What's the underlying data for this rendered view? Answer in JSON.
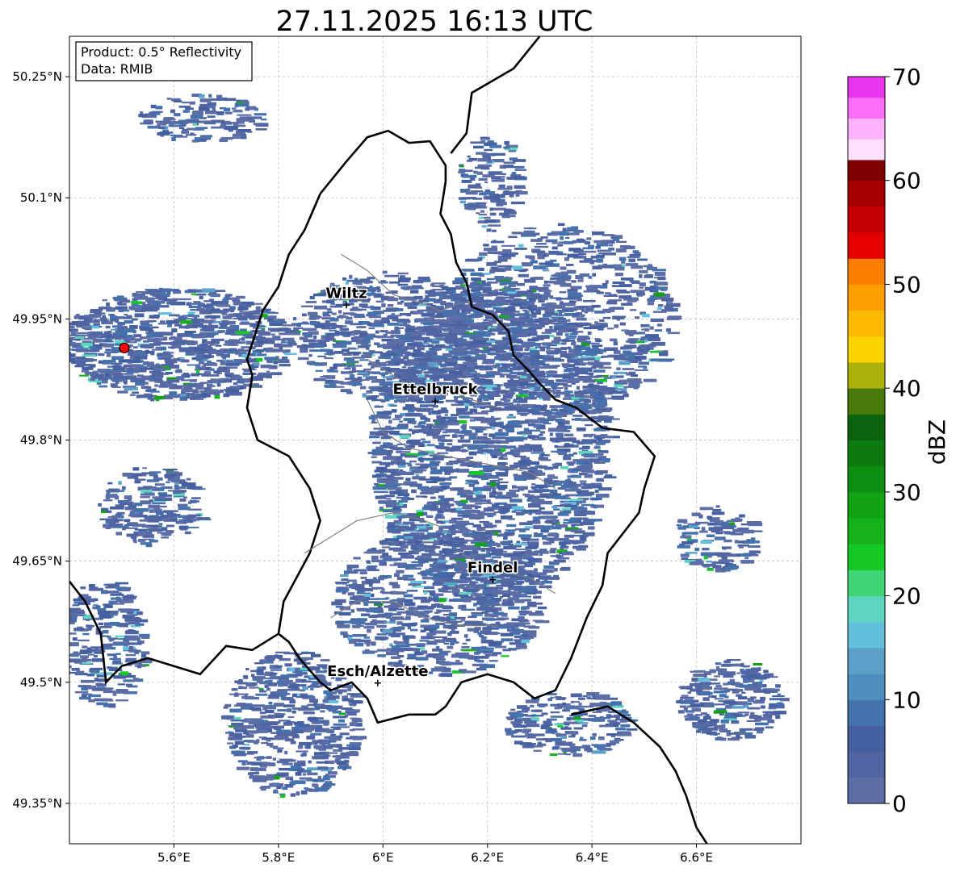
{
  "title": "27.11.2025 16:13 UTC",
  "info_box": {
    "product": "Product: 0.5° Reflectivity",
    "data": "Data: RMIB"
  },
  "map": {
    "lon_range": [
      5.4,
      6.8
    ],
    "lat_range": [
      49.3,
      50.3
    ],
    "lon_ticks": [
      {
        "value": 5.6,
        "label": "5.6°E"
      },
      {
        "value": 5.8,
        "label": "5.8°E"
      },
      {
        "value": 6.0,
        "label": "6°E"
      },
      {
        "value": 6.2,
        "label": "6.2°E"
      },
      {
        "value": 6.4,
        "label": "6.4°E"
      },
      {
        "value": 6.6,
        "label": "6.6°E"
      }
    ],
    "lat_ticks": [
      {
        "value": 50.25,
        "label": "50.25°N"
      },
      {
        "value": 50.1,
        "label": "50.1°N"
      },
      {
        "value": 49.95,
        "label": "49.95°N"
      },
      {
        "value": 49.8,
        "label": "49.8°N"
      },
      {
        "value": 49.65,
        "label": "49.65°N"
      },
      {
        "value": 49.5,
        "label": "49.5°N"
      },
      {
        "value": 49.35,
        "label": "49.35°N"
      }
    ],
    "grid": true,
    "radar_site": {
      "lon": 5.505,
      "lat": 49.914,
      "color": "#ff0000"
    },
    "cities": [
      {
        "name": "Wiltz",
        "lon": 5.93,
        "lat": 49.967
      },
      {
        "name": "Ettelbruck",
        "lon": 6.1,
        "lat": 49.848
      },
      {
        "name": "Findel",
        "lon": 6.21,
        "lat": 49.627
      },
      {
        "name": "Esch/Alzette",
        "lon": 5.99,
        "lat": 49.499
      }
    ]
  },
  "colorbar": {
    "label": "dBZ",
    "min": 0,
    "max": 70,
    "tick_values": [
      0,
      10,
      20,
      30,
      40,
      50,
      60,
      70
    ],
    "tick_labels": [
      "0",
      "10",
      "20",
      "30",
      "40",
      "50",
      "60",
      "70"
    ],
    "colors": [
      "#5d6ea6",
      "#5165a3",
      "#4560a1",
      "#4472ad",
      "#4f8fc0",
      "#5aa0c8",
      "#63c0dc",
      "#5ed5bf",
      "#3fd474",
      "#15c824",
      "#16b11a",
      "#12a314",
      "#0e8e10",
      "#0d7a10",
      "#0a640e",
      "#487a0b",
      "#abb00a",
      "#fed400",
      "#fdba00",
      "#fd9f00",
      "#fd7f00",
      "#e50000",
      "#c50000",
      "#a40000",
      "#7c0000",
      "#ffdffe",
      "#ffb3fc",
      "#fe6efb",
      "#e836ee"
    ]
  }
}
